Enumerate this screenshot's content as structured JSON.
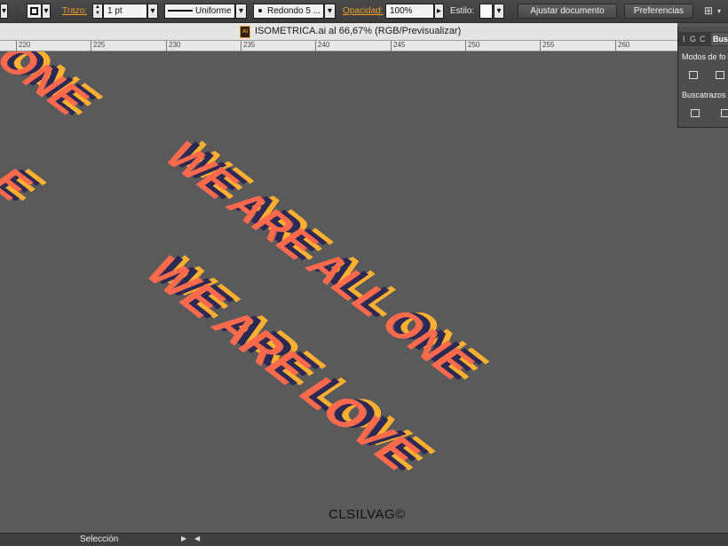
{
  "controlbar": {
    "trazo_label": "Trazo:",
    "stroke_weight": "1 pt",
    "stroke_profile": "Uniforme",
    "brush": "Redondo 5 ...",
    "opacity_label": "Opacidad:",
    "opacity_value": "100%",
    "style_label": "Estilo:",
    "adjust_doc_button": "Ajustar documento",
    "preferences_button": "Preferencias"
  },
  "document": {
    "tab_title": "ISOMETRICA.ai al 66,67% (RGB/Previsualizar)",
    "icon_text": "Ai"
  },
  "ruler": {
    "ticks": [
      "220",
      "225",
      "230",
      "235",
      "240",
      "245",
      "250",
      "255",
      "260"
    ]
  },
  "panel": {
    "tabs": [
      "I",
      "G",
      "C",
      "Busc"
    ],
    "section1": "Modos de fo",
    "section2": "Buscatrazos"
  },
  "artwork": {
    "line1": "WE ARE ALL ONE",
    "line2": "WE ARE LOVE",
    "fragment_top": "ONE",
    "fragment_left": "E",
    "signature": "CLSILVAG©",
    "colors": {
      "face": "#ff6a4d",
      "top": "#ffb02e",
      "side": "#2c2a55",
      "background": "#5a5a5a"
    }
  },
  "statusbar": {
    "tool_name": "Selección"
  }
}
